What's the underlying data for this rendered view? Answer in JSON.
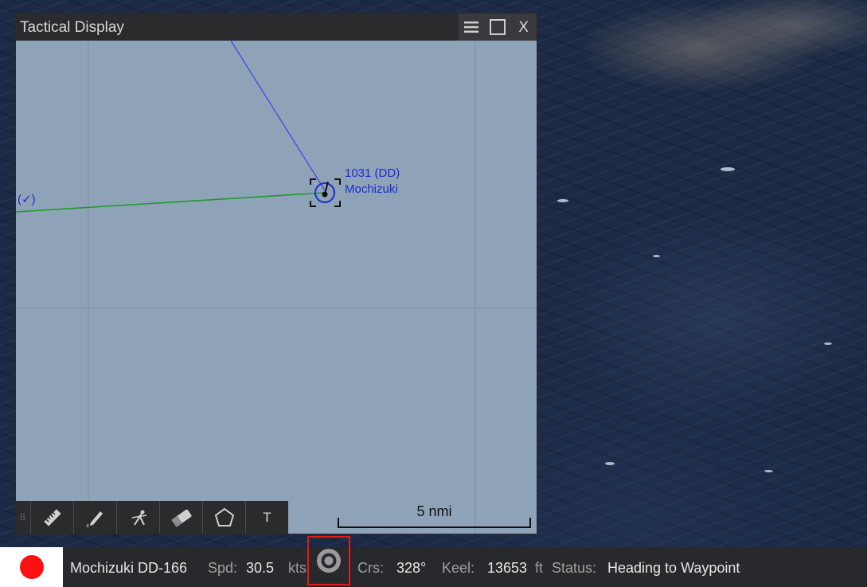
{
  "window": {
    "title": "Tactical Display",
    "buttons": {
      "menu_icon": "menu-icon",
      "maximize_icon": "maximize-icon",
      "close_label": "X"
    }
  },
  "map": {
    "background_color": "#8fa3b8",
    "unit": {
      "id_line": "1031 (DD)",
      "name": "Mochizuki",
      "color": "#1c2bd0"
    },
    "waypoint_marker": "(✓)",
    "scale_label": "5 nmi"
  },
  "draw_toolbar": {
    "tools": [
      {
        "name": "ruler-tool",
        "icon": "ruler-icon"
      },
      {
        "name": "pen-tool",
        "icon": "pencil-icon"
      },
      {
        "name": "compass-tool",
        "icon": "compass-icon"
      },
      {
        "name": "eraser-tool",
        "icon": "eraser-icon"
      },
      {
        "name": "polygon-tool",
        "icon": "pentagon-icon"
      },
      {
        "name": "text-tool",
        "label": "T"
      }
    ]
  },
  "status_bar": {
    "flag_color": "#ff1010",
    "unit_name": "Mochizuki DD-166",
    "speed_key": "Spd:",
    "speed_value": "30.5",
    "speed_unit": "kts",
    "course_key": "Crs:",
    "course_value": "328°",
    "keel_key": "Keel:",
    "keel_value": "13653",
    "keel_unit": "ft",
    "status_key": "Status:",
    "status_value": "Heading to Waypoint"
  },
  "colors": {
    "friendly_track": "#2a2fe0",
    "waypoint_line": "#1f9a2a",
    "highlight": "#e21a1a"
  }
}
